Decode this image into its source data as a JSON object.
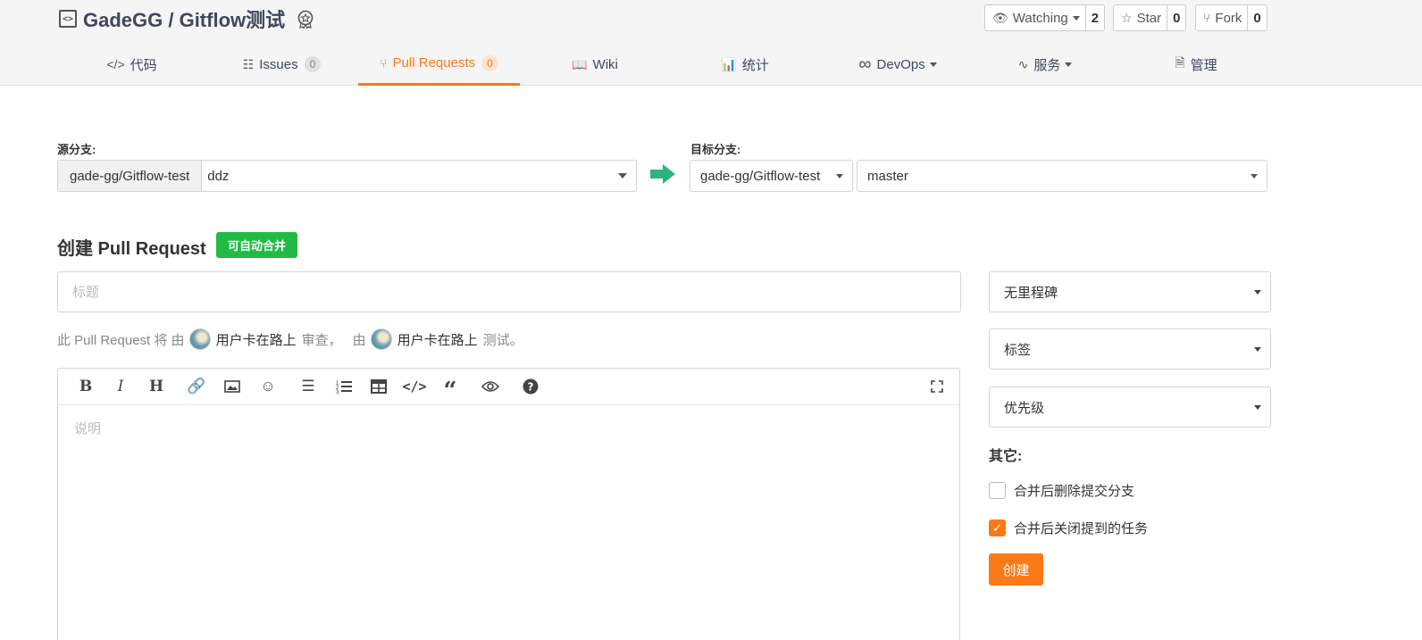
{
  "repo": {
    "title": "GadeGG / Gitflow测试"
  },
  "social": {
    "watching_label": "Watching",
    "watching_count": "2",
    "star_label": "Star",
    "star_count": "0",
    "fork_label": "Fork",
    "fork_count": "0"
  },
  "nav": {
    "code": "代码",
    "issues": "Issues",
    "issues_count": "0",
    "pull_requests": "Pull Requests",
    "pull_requests_count": "0",
    "wiki": "Wiki",
    "stats": "统计",
    "devops": "DevOps",
    "services": "服务",
    "manage": "管理"
  },
  "branches": {
    "source_label": "源分支:",
    "source_repo": "gade-gg/Gitflow-test",
    "source_branch": "ddz",
    "target_label": "目标分支:",
    "target_repo": "gade-gg/Gitflow-test",
    "target_branch": "master"
  },
  "create": {
    "heading": "创建 Pull Request",
    "merge_badge": "可自动合并",
    "title_placeholder": "标题",
    "reviewer_prefix": "此 Pull Request 将 由",
    "reviewer_name": "用户卡在路上",
    "reviewer_action": "审查，",
    "tester_prefix": "由",
    "tester_name": "用户卡在路上",
    "tester_action": "测试。",
    "description_placeholder": "说明"
  },
  "sidebar": {
    "milestone": "无里程碑",
    "labels": "标签",
    "priority": "优先级",
    "other_heading": "其它:",
    "delete_branch_label": "合并后删除提交分支",
    "delete_branch_checked": false,
    "close_tasks_label": "合并后关闭提到的任务",
    "close_tasks_checked": true,
    "create_button": "创建"
  },
  "colors": {
    "accent": "#fa7a17",
    "success": "#21ba45",
    "arrow": "#2fb37e"
  }
}
